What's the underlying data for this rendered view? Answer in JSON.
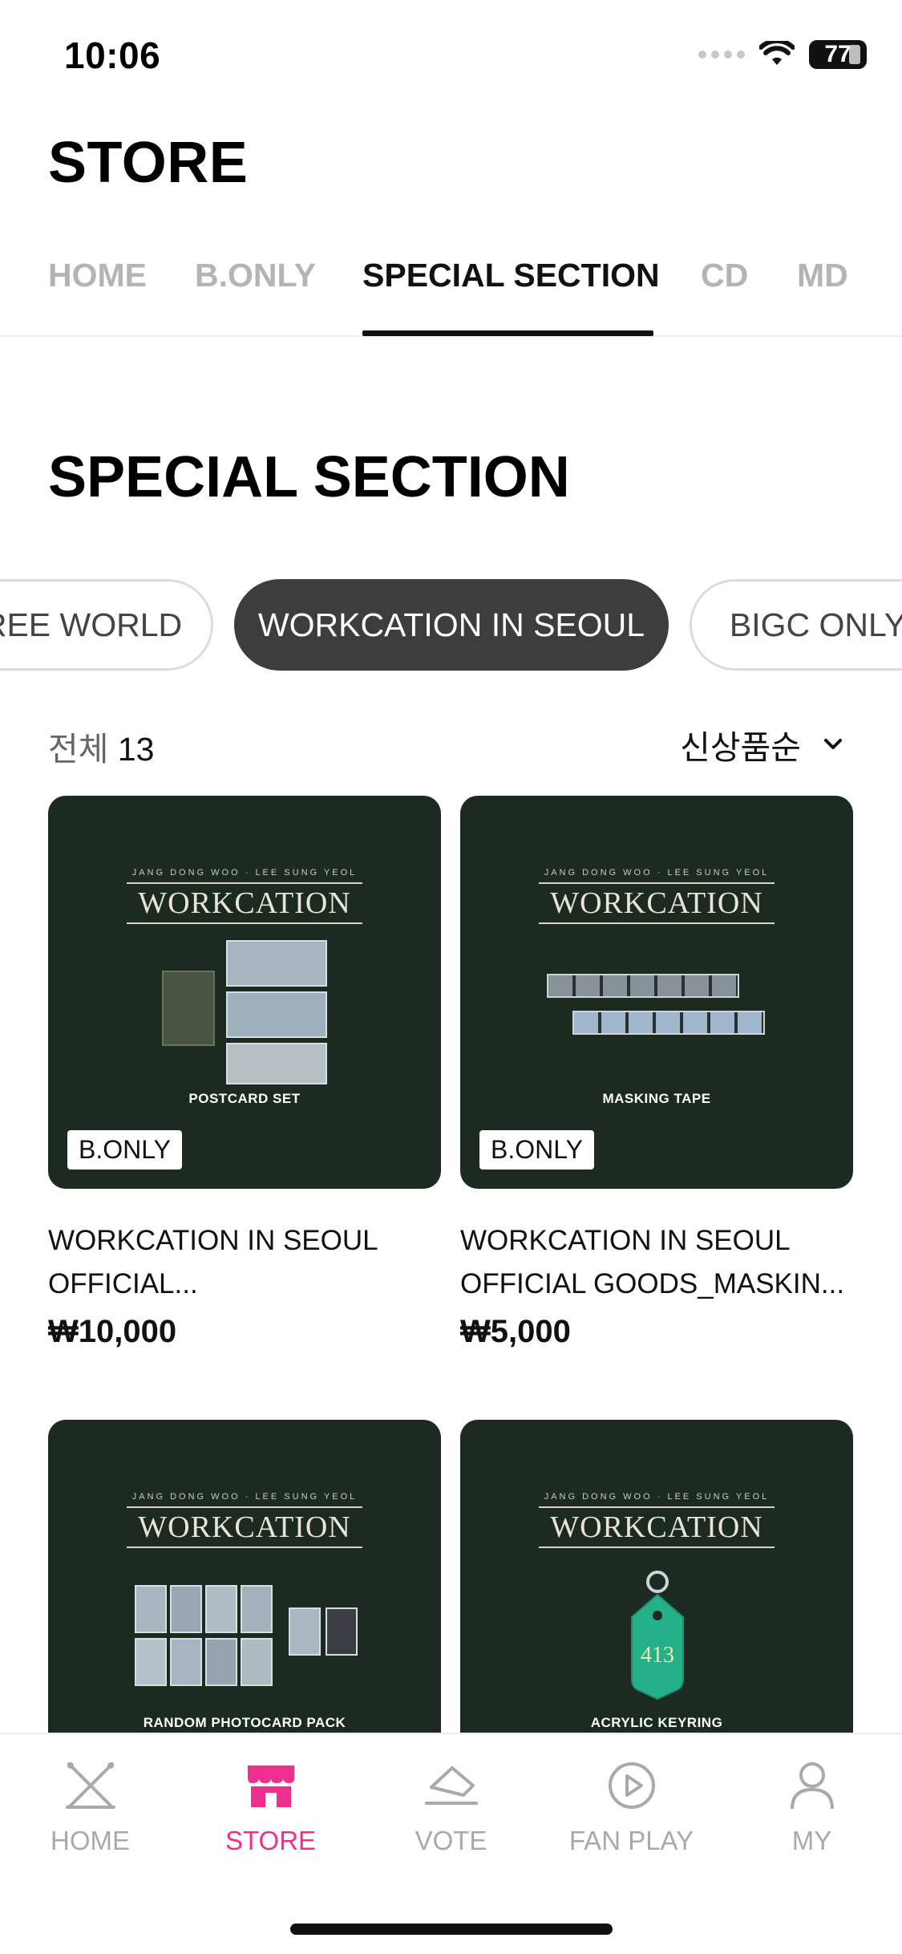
{
  "status": {
    "time": "10:06",
    "battery": "77"
  },
  "header": {
    "title": "STORE"
  },
  "tabs": [
    {
      "label": "HOME"
    },
    {
      "label": "B.ONLY"
    },
    {
      "label": "SPECIAL SECTION",
      "active": true
    },
    {
      "label": "CD"
    },
    {
      "label": "MD"
    }
  ],
  "section": {
    "title": "SPECIAL SECTION"
  },
  "chips": [
    {
      "label": "REE WORLD"
    },
    {
      "label": "WORKCATION IN SEOUL",
      "active": true
    },
    {
      "label": "BIGC ONLY"
    }
  ],
  "list": {
    "count_label": "전체",
    "count": "13",
    "sort_label": "신상품순"
  },
  "products": [
    {
      "brand_small": "JANG DONG WOO · LEE SUNG YEOL",
      "brand_word": "WORKCATION",
      "caption": "POSTCARD SET",
      "badge": "B.ONLY",
      "name": "WORKCATION IN SEOUL OFFICIAL...",
      "price": "₩10,000"
    },
    {
      "brand_small": "JANG DONG WOO · LEE SUNG YEOL",
      "brand_word": "WORKCATION",
      "caption": "MASKING TAPE",
      "badge": "B.ONLY",
      "name": "WORKCATION IN SEOUL OFFICIAL GOODS_MASKIN...",
      "price": "₩5,000"
    },
    {
      "brand_small": "JANG DONG WOO · LEE SUNG YEOL",
      "brand_word": "WORKCATION",
      "caption": "RANDOM PHOTOCARD PACK",
      "badge": "",
      "name": "",
      "price": ""
    },
    {
      "brand_small": "JANG DONG WOO · LEE SUNG YEOL",
      "brand_word": "WORKCATION",
      "caption": "ACRYLIC KEYRING",
      "badge": "",
      "name": "",
      "price": "",
      "keyring_number": "413"
    }
  ],
  "bottom_nav": [
    {
      "label": "HOME"
    },
    {
      "label": "STORE",
      "active": true
    },
    {
      "label": "VOTE"
    },
    {
      "label": "FAN PLAY"
    },
    {
      "label": "MY"
    }
  ],
  "colors": {
    "accent": "#ee2f8e",
    "card_bg": "#1c2a22",
    "chip_active": "#3d3d3d"
  }
}
